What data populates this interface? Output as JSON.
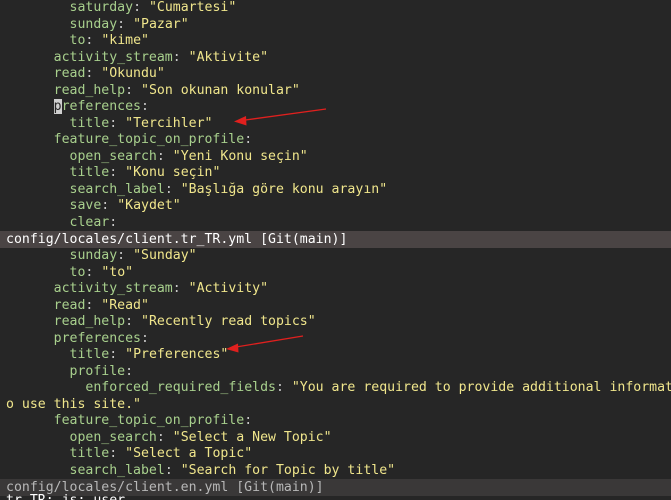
{
  "top_pane": {
    "lines": [
      {
        "indent": "        ",
        "key": "saturday",
        "value": "\"Cumartesi\""
      },
      {
        "indent": "        ",
        "key": "sunday",
        "value": "\"Pazar\""
      },
      {
        "indent": "        ",
        "key": "to",
        "value": "\"kime\""
      },
      {
        "indent": "      ",
        "key": "activity_stream",
        "value": "\"Aktivite\""
      },
      {
        "indent": "      ",
        "key": "read",
        "value": "\"Okundu\""
      },
      {
        "indent": "      ",
        "key": "read_help",
        "value": "\"Son okunan konular\""
      },
      {
        "indent": "      ",
        "key_cursor": "p",
        "key": "references",
        "value": ""
      },
      {
        "indent": "        ",
        "key": "title",
        "value": "\"Tercihler\""
      },
      {
        "indent": "      ",
        "key": "feature_topic_on_profile",
        "value": ""
      },
      {
        "indent": "        ",
        "key": "open_search",
        "value": "\"Yeni Konu seçin\""
      },
      {
        "indent": "        ",
        "key": "title",
        "value": "\"Konu seçin\""
      },
      {
        "indent": "        ",
        "key": "search_label",
        "value": "\"Başlığa göre konu arayın\""
      },
      {
        "indent": "        ",
        "key": "save",
        "value": "\"Kaydet\""
      },
      {
        "indent": "        ",
        "key": "clear",
        "value": ""
      }
    ]
  },
  "top_status": "config/locales/client.tr_TR.yml [Git(main)]",
  "bottom_pane": {
    "lines": [
      {
        "indent": "        ",
        "key": "sunday",
        "value": "\"Sunday\""
      },
      {
        "indent": "        ",
        "key": "to",
        "value": "\"to\""
      },
      {
        "indent": "      ",
        "key": "activity_stream",
        "value": "\"Activity\""
      },
      {
        "indent": "      ",
        "key": "read",
        "value": "\"Read\""
      },
      {
        "indent": "      ",
        "key": "read_help",
        "value": "\"Recently read topics\""
      },
      {
        "indent": "      ",
        "key": "preferences",
        "value": ""
      },
      {
        "indent": "        ",
        "key": "title",
        "value": "\"Preferences\""
      },
      {
        "indent": "        ",
        "key": "profile",
        "value": ""
      },
      {
        "indent": "          ",
        "key": "enforced_required_fields",
        "value": "\"You are required to provide additional information"
      },
      {
        "indent": "",
        "key": "",
        "value": "o use this site.\"",
        "wrap": true
      },
      {
        "indent": "      ",
        "key": "feature_topic_on_profile",
        "value": ""
      },
      {
        "indent": "        ",
        "key": "open_search",
        "value": "\"Select a New Topic\""
      },
      {
        "indent": "        ",
        "key": "title",
        "value": "\"Select a Topic\""
      },
      {
        "indent": "        ",
        "key": "search_label",
        "value": "\"Search for Topic by title\""
      }
    ]
  },
  "bottom_status": "config/locales/client.en.yml [Git(main)]",
  "command_line": "tr_TR: js: user",
  "colors": {
    "background": "#262626",
    "key": "#a8d08d",
    "string": "#f0e68c",
    "arrow": "#e0201e"
  }
}
